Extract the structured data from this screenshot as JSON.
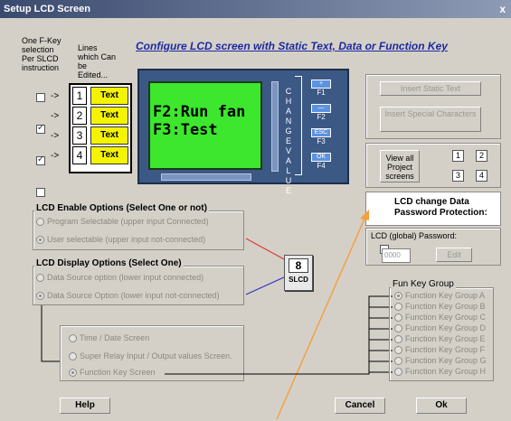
{
  "window": {
    "title": "Setup LCD Screen",
    "close": "x"
  },
  "header": {
    "fkey_col": "One F-Key selection Per SLCD instruction",
    "lines_col": "Lines which Can be Edited...",
    "title": "Configure LCD screen with Static Text, Data or Function Key"
  },
  "lines": [
    {
      "checked": false,
      "arrow": "->",
      "number": "1",
      "label": "Text"
    },
    {
      "checked": true,
      "arrow": "->",
      "number": "2",
      "label": "Text"
    },
    {
      "checked": true,
      "arrow": "->",
      "number": "3",
      "label": "Text"
    },
    {
      "checked": false,
      "arrow": "->",
      "number": "4",
      "label": "Text"
    }
  ],
  "lcd": {
    "line1": "F2:Run fan",
    "line2": "F3:Test",
    "side_label": "CHANGE VALUE",
    "fkeys": [
      {
        "button": "+",
        "label": "F1"
      },
      {
        "button": "—",
        "label": "F2"
      },
      {
        "button": "ESC",
        "label": "F3"
      },
      {
        "button": "OK",
        "label": "F4"
      }
    ]
  },
  "right_panel": {
    "insert_static": "Insert Static Text",
    "insert_special": "Insert Special Characters",
    "view_all": "View all Project screens",
    "screen_nums": [
      "1",
      "2",
      "3",
      "4"
    ],
    "password_check_label": "LCD change Data Password Protection:",
    "password_label": "LCD (global) Password:",
    "password_value": "0000",
    "edit_button": "Edit"
  },
  "enable_group": {
    "title": "LCD Enable Options (Select One or not)",
    "options": [
      "Program Selectable (upper input Connected)",
      "User selectable (upper input not-connected)"
    ],
    "selected": 1
  },
  "display_group": {
    "title": "LCD Display Options (Select One)",
    "options": [
      "Data Source option (lower input connected)",
      "Data Source Option (lower input not-connected)"
    ],
    "selected": 1
  },
  "block": {
    "number": "8",
    "label": "SLCD"
  },
  "screen_group": {
    "options": [
      "Time / Date Screen",
      "Super Relay Input / Output values Screen.",
      "Function Key Screen"
    ],
    "selected": 2
  },
  "funkey_group": {
    "title": "Fun Key Group",
    "options": [
      "Function Key Group A",
      "Function Key Group B",
      "Function Key Group C",
      "Function Key Group D",
      "Function Key Group E",
      "Function Key Group F",
      "Function Key Group G",
      "Function Key Group H"
    ],
    "selected": 0
  },
  "footer": {
    "help": "Help",
    "cancel": "Cancel",
    "ok": "Ok"
  },
  "colors": {
    "title_bar": "#3a4a6e",
    "lcd_green": "#3de72d",
    "text_yellow": "#f4f400",
    "heading_blue": "#1c2aa0",
    "arrow_orange": "#f5a040"
  }
}
